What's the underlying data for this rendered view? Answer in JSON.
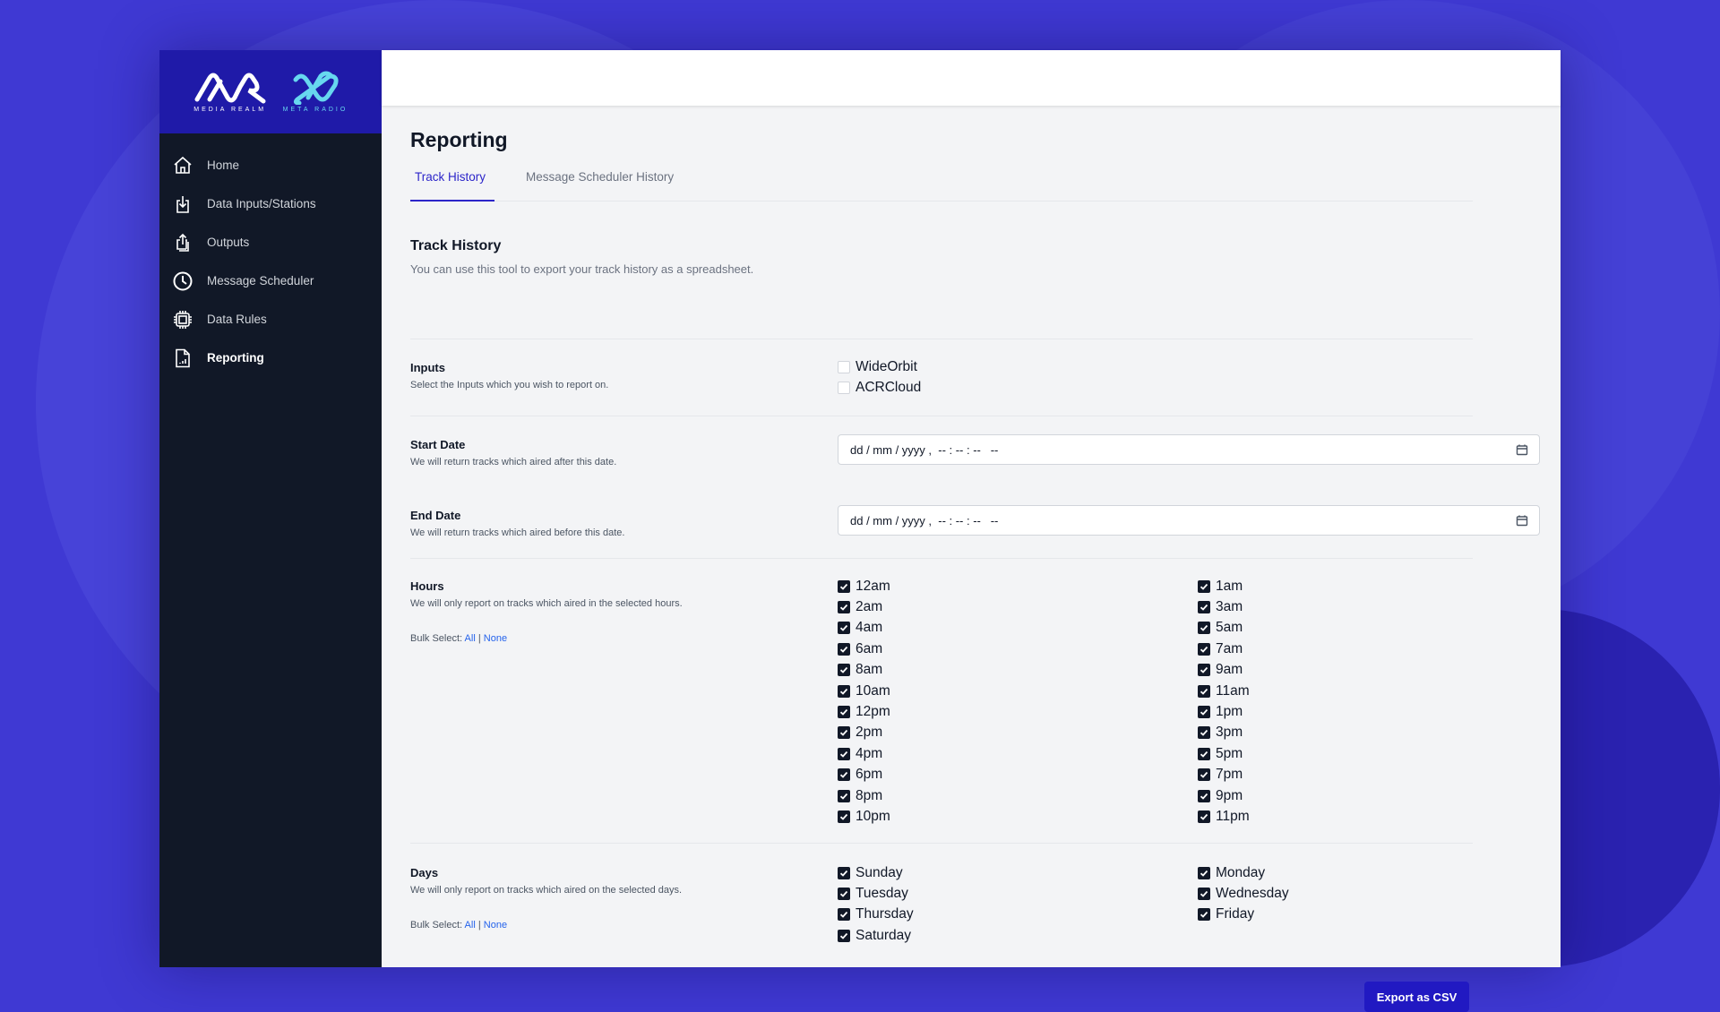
{
  "brand": {
    "logo_primary": "MEDIA REALM",
    "logo_secondary": "META RADIO",
    "accent": "#2c25c9",
    "sidebar_bg": "#111827",
    "logo_bg": "#1f1aa8"
  },
  "sidebar": {
    "items": [
      {
        "label": "Home",
        "icon": "home-icon"
      },
      {
        "label": "Data Inputs/Stations",
        "icon": "download-tray-icon"
      },
      {
        "label": "Outputs",
        "icon": "upload-share-icon"
      },
      {
        "label": "Message Scheduler",
        "icon": "clock-icon"
      },
      {
        "label": "Data Rules",
        "icon": "chip-icon"
      },
      {
        "label": "Reporting",
        "icon": "report-document-icon",
        "active": true
      }
    ]
  },
  "page": {
    "title": "Reporting",
    "tabs": [
      {
        "label": "Track History",
        "active": true
      },
      {
        "label": "Message Scheduler History"
      }
    ]
  },
  "section": {
    "title": "Track History",
    "description": "You can use this tool to export your track history as a spreadsheet."
  },
  "inputs": {
    "label": "Inputs",
    "help": "Select the Inputs which you wish to report on.",
    "options": [
      {
        "label": "WideOrbit",
        "checked": false
      },
      {
        "label": "ACRCloud",
        "checked": false
      }
    ]
  },
  "start_date": {
    "label": "Start Date",
    "help": "We will return tracks which aired after this date.",
    "placeholder": "dd / mm / yyyy ,  -- : -- : --   --"
  },
  "end_date": {
    "label": "End Date",
    "help": "We will return tracks which aired before this date.",
    "placeholder": "dd / mm / yyyy ,  -- : -- : --   --"
  },
  "hours": {
    "label": "Hours",
    "help": "We will only report on tracks which aired in the selected hours.",
    "bulk_label": "Bulk Select:",
    "all": "All",
    "sep": "|",
    "none": "None",
    "options": [
      "12am",
      "1am",
      "2am",
      "3am",
      "4am",
      "5am",
      "6am",
      "7am",
      "8am",
      "9am",
      "10am",
      "11am",
      "12pm",
      "1pm",
      "2pm",
      "3pm",
      "4pm",
      "5pm",
      "6pm",
      "7pm",
      "8pm",
      "9pm",
      "10pm",
      "11pm"
    ],
    "all_checked": true
  },
  "days": {
    "label": "Days",
    "help": "We will only report on tracks which aired on the selected days.",
    "bulk_label": "Bulk Select:",
    "all": "All",
    "sep": "|",
    "none": "None",
    "options": [
      "Sunday",
      "Monday",
      "Tuesday",
      "Wednesday",
      "Thursday",
      "Friday",
      "Saturday"
    ],
    "all_checked": true
  },
  "export_label": "Export as CSV"
}
